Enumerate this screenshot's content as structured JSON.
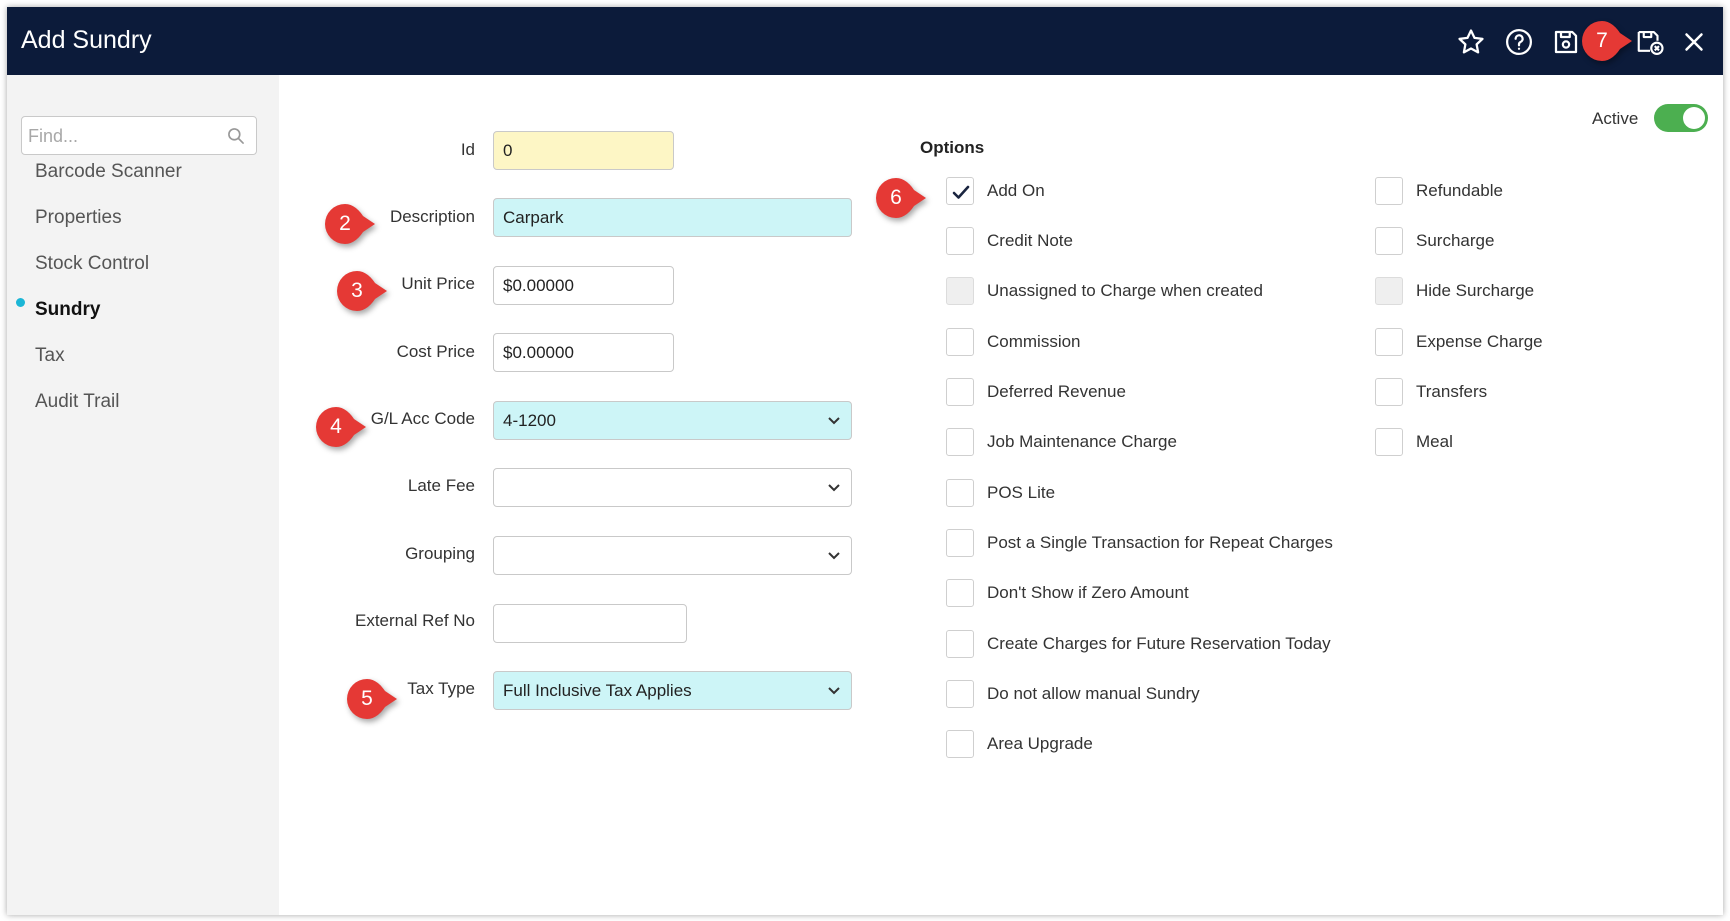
{
  "window": {
    "title": "Add Sundry"
  },
  "toolbar": {
    "icons": [
      "star-icon",
      "help-icon",
      "save-icon",
      "save-close-icon",
      "close-icon"
    ]
  },
  "sidebar": {
    "search_placeholder": "Find...",
    "items": [
      {
        "label": "Barcode Scanner",
        "active": false
      },
      {
        "label": "Properties",
        "active": false
      },
      {
        "label": "Stock Control",
        "active": false
      },
      {
        "label": "Sundry",
        "active": true
      },
      {
        "label": "Tax",
        "active": false
      },
      {
        "label": "Audit Trail",
        "active": false
      }
    ]
  },
  "form": {
    "id": {
      "label": "Id",
      "value": "0"
    },
    "description": {
      "label": "Description",
      "value": "Carpark"
    },
    "unit_price": {
      "label": "Unit Price",
      "value": "$0.00000"
    },
    "cost_price": {
      "label": "Cost Price",
      "value": "$0.00000"
    },
    "gl_acc_code": {
      "label": "G/L Acc Code",
      "value": "4-1200"
    },
    "late_fee": {
      "label": "Late Fee",
      "value": ""
    },
    "grouping": {
      "label": "Grouping",
      "value": ""
    },
    "external_ref_no": {
      "label": "External Ref No",
      "value": ""
    },
    "tax_type": {
      "label": "Tax Type",
      "value": "Full Inclusive Tax Applies"
    }
  },
  "options": {
    "title": "Options",
    "left": [
      {
        "label": "Add On",
        "checked": true,
        "disabled": false
      },
      {
        "label": "Credit Note",
        "checked": false,
        "disabled": false
      },
      {
        "label": "Unassigned to Charge when created",
        "checked": false,
        "disabled": true
      },
      {
        "label": "Commission",
        "checked": false,
        "disabled": false
      },
      {
        "label": "Deferred Revenue",
        "checked": false,
        "disabled": false
      },
      {
        "label": "Job Maintenance Charge",
        "checked": false,
        "disabled": false
      },
      {
        "label": "POS Lite",
        "checked": false,
        "disabled": false
      },
      {
        "label": "Post a Single Transaction for Repeat Charges",
        "checked": false,
        "disabled": false
      },
      {
        "label": "Don't Show if Zero Amount",
        "checked": false,
        "disabled": false
      },
      {
        "label": "Create Charges for Future Reservation Today",
        "checked": false,
        "disabled": false
      },
      {
        "label": "Do not allow manual Sundry",
        "checked": false,
        "disabled": false
      },
      {
        "label": "Area Upgrade",
        "checked": false,
        "disabled": false
      }
    ],
    "right": [
      {
        "label": "Refundable",
        "checked": false,
        "disabled": false
      },
      {
        "label": "Surcharge",
        "checked": false,
        "disabled": false
      },
      {
        "label": "Hide Surcharge",
        "checked": false,
        "disabled": true
      },
      {
        "label": "Expense Charge",
        "checked": false,
        "disabled": false
      },
      {
        "label": "Transfers",
        "checked": false,
        "disabled": false
      },
      {
        "label": "Meal",
        "checked": false,
        "disabled": false
      }
    ]
  },
  "active": {
    "label": "Active",
    "on": true
  },
  "callouts": [
    "2",
    "3",
    "4",
    "5",
    "6",
    "7"
  ],
  "colors": {
    "titlebar": "#0c1b3a",
    "callout": "#e53935",
    "toggle": "#4caf50",
    "highlight": "#cdf5f7",
    "id_field": "#fdf6c5",
    "nav_dot": "#1bb6d6"
  }
}
